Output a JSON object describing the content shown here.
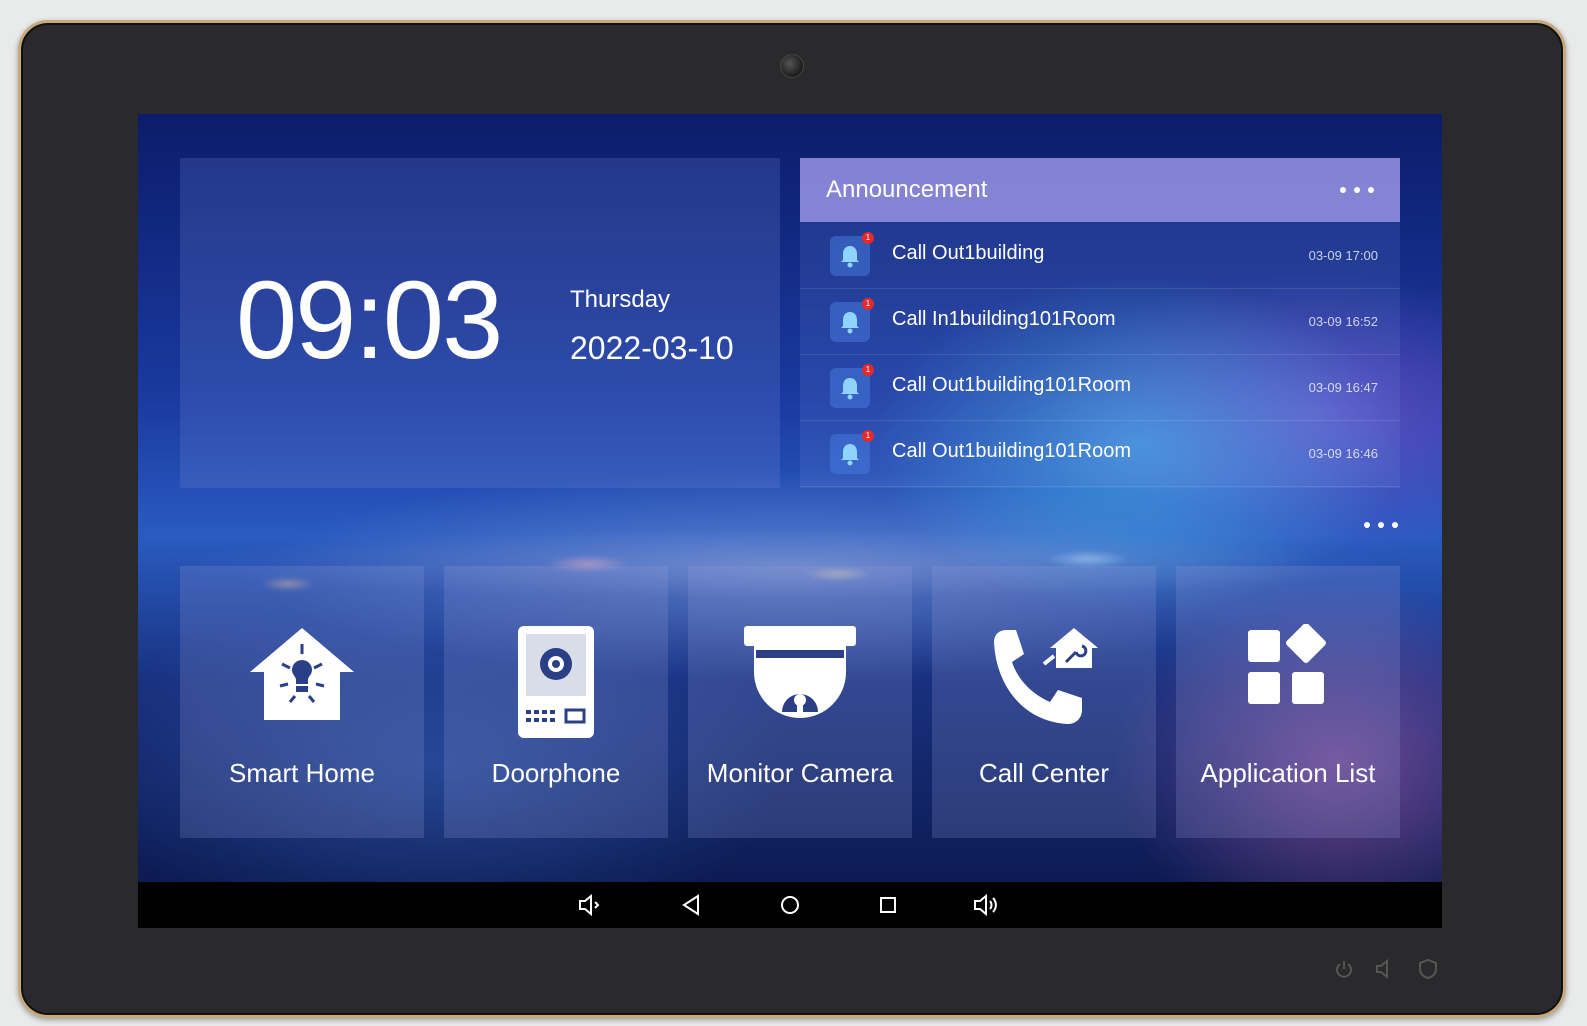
{
  "clock": {
    "time": "09:03",
    "weekday": "Thursday",
    "date": "2022-03-10"
  },
  "announcement": {
    "title": "Announcement",
    "items": [
      {
        "text": "Call Out1building",
        "time": "03-09 17:00",
        "badge": "1"
      },
      {
        "text": "Call In1building101Room",
        "time": "03-09 16:52",
        "badge": "1"
      },
      {
        "text": "Call Out1building101Room",
        "time": "03-09 16:47",
        "badge": "1"
      },
      {
        "text": "Call Out1building101Room",
        "time": "03-09 16:46",
        "badge": "1"
      }
    ]
  },
  "apps": [
    {
      "label": "Smart Home",
      "icon": "smart-home-icon"
    },
    {
      "label": "Doorphone",
      "icon": "doorphone-icon"
    },
    {
      "label": "Monitor Camera",
      "icon": "monitor-camera-icon"
    },
    {
      "label": "Call Center",
      "icon": "call-center-icon"
    },
    {
      "label": "Application List",
      "icon": "application-list-icon"
    }
  ],
  "navbar": {
    "buttons": [
      "volume-down-icon",
      "back-icon",
      "home-icon",
      "recents-icon",
      "volume-up-icon"
    ]
  },
  "hardware_buttons": [
    "power-icon",
    "speaker-icon",
    "shield-icon"
  ],
  "colors": {
    "bezel": "#2a2a2c",
    "bezel_trim": "#c7a97b",
    "announcement_header": "#9691e1",
    "badge": "#e32b2b",
    "navbar": "#000000"
  }
}
